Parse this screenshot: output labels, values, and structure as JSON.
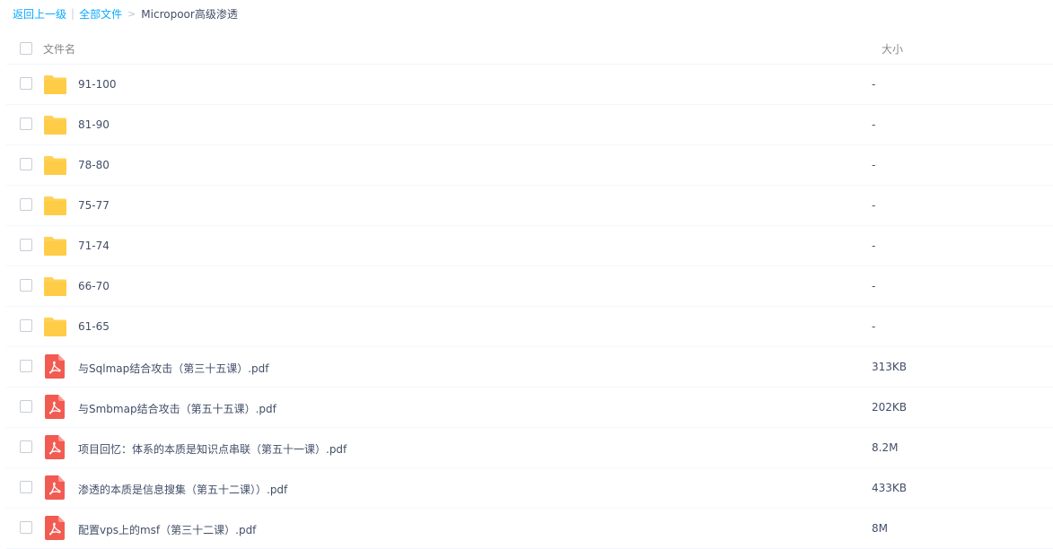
{
  "breadcrumb": {
    "back": "返回上一级",
    "separator": "|",
    "all_files": "全部文件",
    "arrow": ">",
    "current": "Micropoor高级渗透"
  },
  "header": {
    "name_col": "文件名",
    "size_col": "大小"
  },
  "colors": {
    "link": "#09aaff",
    "folder": "#ffd156",
    "pdf": "#f15b52",
    "text": "#424e67"
  },
  "files": [
    {
      "type": "folder",
      "icon": "folder-icon",
      "name": "91-100",
      "size": "-"
    },
    {
      "type": "folder",
      "icon": "folder-icon",
      "name": "81-90",
      "size": "-"
    },
    {
      "type": "folder",
      "icon": "folder-icon",
      "name": "78-80",
      "size": "-"
    },
    {
      "type": "folder",
      "icon": "folder-icon",
      "name": "75-77",
      "size": "-"
    },
    {
      "type": "folder",
      "icon": "folder-icon",
      "name": "71-74",
      "size": "-"
    },
    {
      "type": "folder",
      "icon": "folder-icon",
      "name": "66-70",
      "size": "-"
    },
    {
      "type": "folder",
      "icon": "folder-icon",
      "name": "61-65",
      "size": "-"
    },
    {
      "type": "pdf",
      "icon": "pdf-icon",
      "name": "与Sqlmap结合攻击（第三十五课）.pdf",
      "size": "313KB"
    },
    {
      "type": "pdf",
      "icon": "pdf-icon",
      "name": "与Smbmap结合攻击（第五十五课）.pdf",
      "size": "202KB"
    },
    {
      "type": "pdf",
      "icon": "pdf-icon",
      "name": "项目回忆：体系的本质是知识点串联（第五十一课）.pdf",
      "size": "8.2M"
    },
    {
      "type": "pdf",
      "icon": "pdf-icon",
      "name": "渗透的本质是信息搜集（第五十二课））.pdf",
      "size": "433KB"
    },
    {
      "type": "pdf",
      "icon": "pdf-icon",
      "name": "配置vps上的msf（第三十二课）.pdf",
      "size": "8M"
    }
  ]
}
